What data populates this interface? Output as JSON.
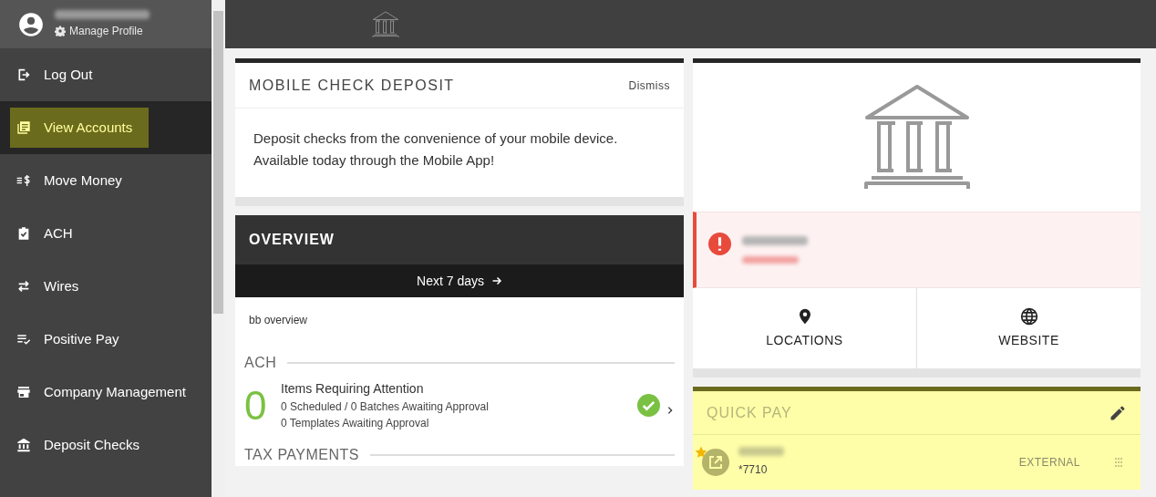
{
  "profile": {
    "manage_label": "Manage Profile"
  },
  "sidebar": {
    "items": [
      {
        "label": "Log Out",
        "kind": "logout",
        "selected": false
      },
      {
        "label": "View Accounts",
        "kind": "accounts",
        "selected": true
      },
      {
        "label": "Move Money",
        "kind": "money",
        "selected": false
      },
      {
        "label": "ACH",
        "kind": "clipboard",
        "selected": false
      },
      {
        "label": "Wires",
        "kind": "swap",
        "selected": false
      },
      {
        "label": "Positive Pay",
        "kind": "checklist",
        "selected": false
      },
      {
        "label": "Company Management",
        "kind": "store",
        "selected": false
      },
      {
        "label": "Deposit Checks",
        "kind": "bank",
        "selected": false
      }
    ]
  },
  "mobile_deposit": {
    "title": "MOBILE CHECK DEPOSIT",
    "dismiss": "Dismiss",
    "body": "Deposit checks from the convenience of your mobile device. Available today through the Mobile App!"
  },
  "overview": {
    "title": "OVERVIEW",
    "range": "Next 7 days",
    "subtitle": "bb overview",
    "sections": [
      {
        "title": "ACH",
        "count": "0",
        "headline": "Items Requiring Attention",
        "lines": [
          "0 Scheduled / 0 Batches Awaiting Approval",
          "0 Templates Awaiting Approval"
        ],
        "ok": true
      },
      {
        "title": "TAX PAYMENTS"
      }
    ]
  },
  "bank_card": {
    "links": [
      {
        "label": "LOCATIONS",
        "kind": "pin"
      },
      {
        "label": "WEBSITE",
        "kind": "globe"
      }
    ]
  },
  "quick_pay": {
    "title": "QUICK PAY",
    "payees": [
      {
        "account": "*7710",
        "type": "EXTERNAL",
        "favorite": true
      }
    ]
  }
}
